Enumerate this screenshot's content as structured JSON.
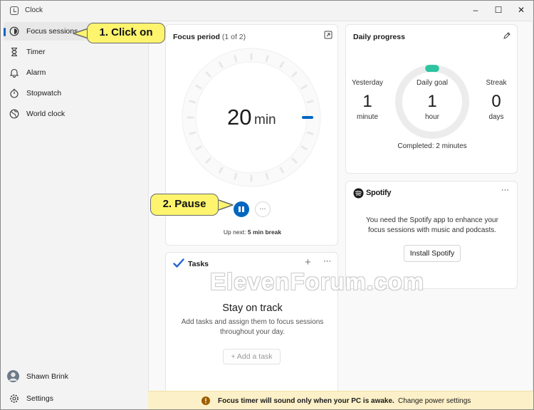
{
  "window": {
    "title": "Clock",
    "minimize": "–",
    "maximize": "☐",
    "close": "✕"
  },
  "sidebar": {
    "items": [
      {
        "label": "Focus sessions",
        "icon": "focus-icon",
        "active": true
      },
      {
        "label": "Timer",
        "icon": "hourglass-icon",
        "active": false
      },
      {
        "label": "Alarm",
        "icon": "bell-icon",
        "active": false
      },
      {
        "label": "Stopwatch",
        "icon": "stopwatch-icon",
        "active": false
      },
      {
        "label": "World clock",
        "icon": "globe-icon",
        "active": false
      }
    ],
    "user_name": "Shawn Brink",
    "settings_label": "Settings"
  },
  "focus": {
    "title": "Focus period",
    "counter": "(1 of 2)",
    "minutes": "20",
    "unit": "min",
    "up_next_label": "Up next:",
    "up_next_value": "5 min break",
    "more": "···"
  },
  "daily": {
    "title": "Daily progress",
    "yesterday_label": "Yesterday",
    "yesterday_value": "1",
    "yesterday_unit": "minute",
    "goal_label": "Daily goal",
    "goal_value": "1",
    "goal_unit": "hour",
    "streak_label": "Streak",
    "streak_value": "0",
    "streak_unit": "days",
    "completed": "Completed: 2 minutes",
    "accent": "#2ec4a0"
  },
  "spotify": {
    "brand": "Spotify",
    "more": "···",
    "message": "You need the Spotify app to enhance your focus sessions with music and podcasts.",
    "install_label": "Install Spotify"
  },
  "tasks": {
    "title": "Tasks",
    "add_icon": "+",
    "more": "···",
    "heading": "Stay on track",
    "sub": "Add tasks and assign them to focus sessions throughout your day.",
    "add_task_label": "+  Add a task"
  },
  "banner": {
    "message": "Focus timer will sound only when your PC is awake.",
    "link": "Change power settings",
    "icon": "warning-icon"
  },
  "callouts": {
    "step1": "1. Click on",
    "step2": "2. Pause"
  },
  "watermark": "ElevenForum.com",
  "colors": {
    "accent": "#0067c0",
    "callout": "#fef46e"
  }
}
